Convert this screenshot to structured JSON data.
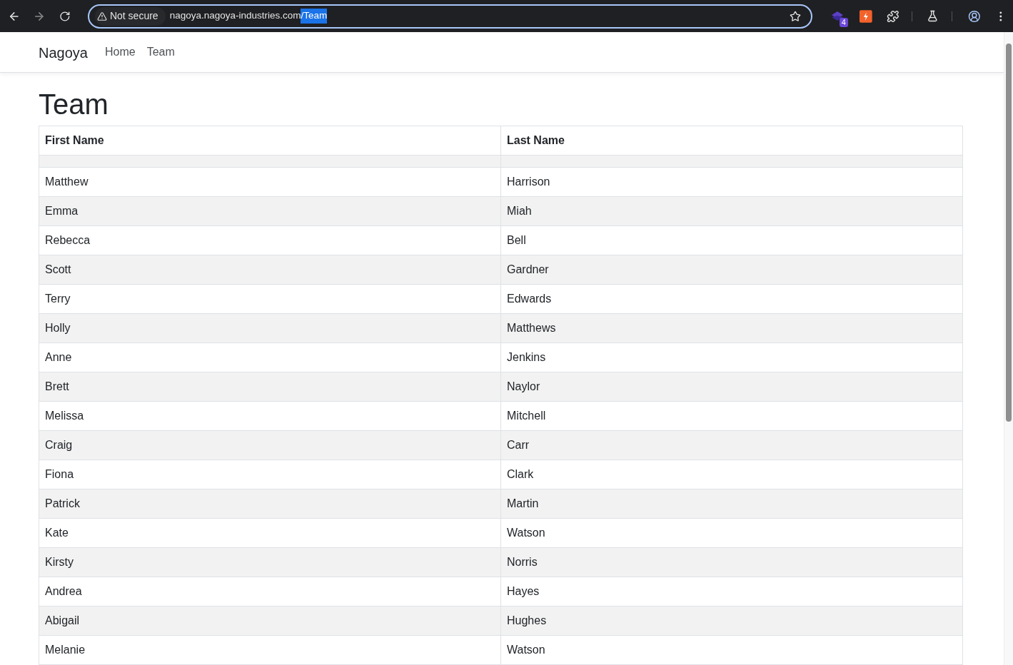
{
  "browser": {
    "security_label": "Not secure",
    "url_host": "nagoya.nagoya-industries.com",
    "url_selected": "/Team",
    "extension_badge": "4"
  },
  "navbar": {
    "brand": "Nagoya",
    "links": [
      "Home",
      "Team"
    ]
  },
  "page_title": "Team",
  "table": {
    "columns": [
      "First Name",
      "Last Name"
    ],
    "rows": [
      {
        "kind": "spacer"
      },
      {
        "kind": "person",
        "first": "Matthew",
        "last": "Harrison"
      },
      {
        "kind": "person",
        "first": "Emma",
        "last": "Miah"
      },
      {
        "kind": "person",
        "first": "Rebecca",
        "last": "Bell"
      },
      {
        "kind": "person",
        "first": "Scott",
        "last": "Gardner"
      },
      {
        "kind": "person",
        "first": "Terry",
        "last": "Edwards"
      },
      {
        "kind": "person",
        "first": "Holly",
        "last": "Matthews"
      },
      {
        "kind": "person",
        "first": "Anne",
        "last": "Jenkins"
      },
      {
        "kind": "person",
        "first": "Brett",
        "last": "Naylor"
      },
      {
        "kind": "person",
        "first": "Melissa",
        "last": "Mitchell"
      },
      {
        "kind": "person",
        "first": "Craig",
        "last": "Carr"
      },
      {
        "kind": "person",
        "first": "Fiona",
        "last": "Clark"
      },
      {
        "kind": "person",
        "first": "Patrick",
        "last": "Martin"
      },
      {
        "kind": "person",
        "first": "Kate",
        "last": "Watson"
      },
      {
        "kind": "person",
        "first": "Kirsty",
        "last": "Norris"
      },
      {
        "kind": "person",
        "first": "Andrea",
        "last": "Hayes"
      },
      {
        "kind": "person",
        "first": "Abigail",
        "last": "Hughes"
      },
      {
        "kind": "person",
        "first": "Melanie",
        "last": "Watson"
      }
    ]
  }
}
